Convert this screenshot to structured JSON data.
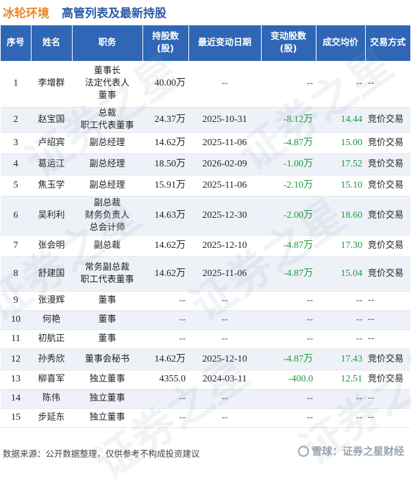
{
  "header": {
    "company": "冰轮环境",
    "title": "高管列表及最新持股"
  },
  "columns": [
    "序号",
    "姓名",
    "职务",
    "持股数\n(股)",
    "最近变动日期",
    "变动股数\n(股)",
    "成交均价",
    "交易方式"
  ],
  "rows": [
    {
      "no": "1",
      "name": "李增群",
      "role": [
        "董事长",
        "法定代表人",
        "董事"
      ],
      "shares": "40.00万",
      "date": "--",
      "change": "--",
      "price": "--",
      "method": "--"
    },
    {
      "no": "2",
      "name": "赵宝国",
      "role": [
        "总裁",
        "职工代表董事"
      ],
      "shares": "24.37万",
      "date": "2025-10-31",
      "change": "-8.12万",
      "price": "14.44",
      "method": "竞价交易"
    },
    {
      "no": "3",
      "name": "卢绍宾",
      "role": [
        "副总经理"
      ],
      "shares": "14.62万",
      "date": "2025-11-06",
      "change": "-4.87万",
      "price": "15.00",
      "method": "竞价交易"
    },
    {
      "no": "4",
      "name": "葛运江",
      "role": [
        "副总经理"
      ],
      "shares": "18.50万",
      "date": "2026-02-09",
      "change": "-1.00万",
      "price": "17.52",
      "method": "竞价交易"
    },
    {
      "no": "5",
      "name": "焦玉学",
      "role": [
        "副总经理"
      ],
      "shares": "15.91万",
      "date": "2025-11-06",
      "change": "-2.10万",
      "price": "15.10",
      "method": "竞价交易"
    },
    {
      "no": "6",
      "name": "吴利利",
      "role": [
        "副总裁",
        "财务负责人",
        "总会计师"
      ],
      "shares": "14.63万",
      "date": "2025-12-30",
      "change": "-2.00万",
      "price": "18.60",
      "method": "竞价交易"
    },
    {
      "no": "7",
      "name": "张会明",
      "role": [
        "副总裁"
      ],
      "shares": "14.62万",
      "date": "2025-12-10",
      "change": "-4.87万",
      "price": "17.30",
      "method": "竞价交易"
    },
    {
      "no": "8",
      "name": "舒建国",
      "role": [
        "常务副总裁",
        "职工代表董事"
      ],
      "shares": "14.62万",
      "date": "2025-11-06",
      "change": "-4.87万",
      "price": "15.04",
      "method": "竞价交易"
    },
    {
      "no": "9",
      "name": "张漫辉",
      "role": [
        "董事"
      ],
      "shares": "--",
      "date": "--",
      "change": "--",
      "price": "--",
      "method": "--"
    },
    {
      "no": "10",
      "name": "何艳",
      "role": [
        "董事"
      ],
      "shares": "--",
      "date": "--",
      "change": "--",
      "price": "--",
      "method": "--"
    },
    {
      "no": "11",
      "name": "初航正",
      "role": [
        "董事"
      ],
      "shares": "--",
      "date": "--",
      "change": "--",
      "price": "--",
      "method": "--"
    },
    {
      "no": "12",
      "name": "孙秀欣",
      "role": [
        "董事会秘书"
      ],
      "shares": "14.62万",
      "date": "2025-12-10",
      "change": "-4.87万",
      "price": "17.43",
      "method": "竞价交易"
    },
    {
      "no": "13",
      "name": "柳喜军",
      "role": [
        "独立董事"
      ],
      "shares": "4355.0",
      "date": "2024-03-11",
      "change": "-400.0",
      "price": "12.51",
      "method": "竞价交易"
    },
    {
      "no": "14",
      "name": "陈伟",
      "role": [
        "独立董事"
      ],
      "shares": "--",
      "date": "--",
      "change": "--",
      "price": "--",
      "method": "--"
    },
    {
      "no": "15",
      "name": "步延东",
      "role": [
        "独立董事"
      ],
      "shares": "--",
      "date": "--",
      "change": "--",
      "price": "--",
      "method": "--"
    }
  ],
  "footer": {
    "source": "数据来源：公开数据整理，仅供参考不构成投资建议",
    "brand": "雪球：证券之星财经"
  },
  "watermark": "证券之星",
  "colors": {
    "header_bg": "#2f66b5",
    "title": "#2a5ba8",
    "company": "#e8892b",
    "positive_change": "#1a9a3a",
    "stripe": "#eef2f8"
  }
}
